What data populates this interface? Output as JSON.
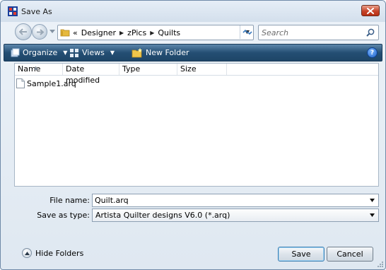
{
  "window": {
    "title": "Save As"
  },
  "address": {
    "overflow": "«",
    "crumbs": [
      "Designer",
      "zPics",
      "Quilts"
    ]
  },
  "search": {
    "placeholder": "Search"
  },
  "toolbar": {
    "organize_label": "Organize",
    "views_label": "Views",
    "new_folder_label": "New Folder",
    "help_label": "?"
  },
  "file_list": {
    "columns": [
      "Name",
      "Date modified",
      "Type",
      "Size"
    ],
    "files": [
      {
        "name": "Sample1.arq"
      }
    ]
  },
  "form": {
    "file_name_label": "File name:",
    "file_name_value": "Quilt.arq",
    "save_type_label": "Save as type:",
    "save_type_value": "Artista Quilter designs V6.0 (*.arq)"
  },
  "footer": {
    "hide_folders_label": "Hide Folders",
    "save_label": "Save",
    "cancel_label": "Cancel"
  },
  "colors": {
    "toolbar": "#244e73",
    "close": "#c7452b",
    "accent_border": "#3c7fb1"
  },
  "icons": {
    "app": "app-grid-icon",
    "close": "close-icon",
    "back": "back-arrow-icon",
    "forward": "forward-arrow-icon",
    "folder": "folder-icon",
    "refresh": "refresh-icon",
    "search": "search-icon",
    "organize": "organize-icon",
    "views": "views-icon",
    "new_folder": "new-folder-icon",
    "help": "help-icon",
    "file": "file-icon",
    "hide": "chevron-up-icon"
  }
}
